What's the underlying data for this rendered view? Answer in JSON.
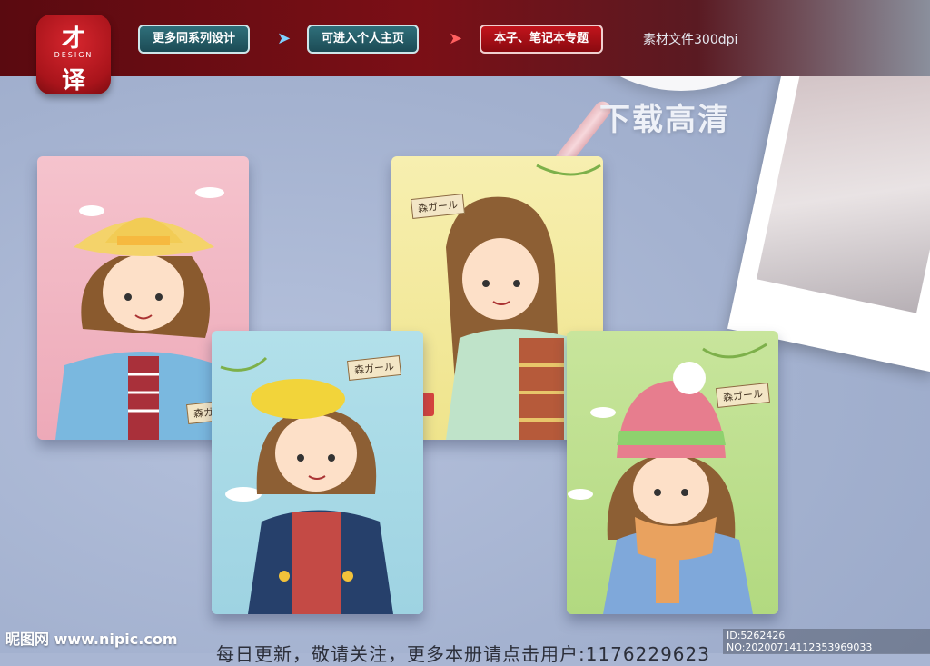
{
  "header": {
    "logo": {
      "line1": "才",
      "line2": "DESIGN",
      "line3": "译"
    },
    "nav": [
      {
        "label": "更多同系列设计"
      },
      {
        "label": "可进入个人主页"
      },
      {
        "label": "本子、笔记本专题"
      }
    ],
    "dpi_text": "素材文件300dpi"
  },
  "download_text": "下载高清",
  "cards": [
    {
      "label": "森ガール",
      "color": "#f2b8c4"
    },
    {
      "label": "森ガール",
      "color": "#f6eda6"
    },
    {
      "label": "森ガール",
      "color": "#a7d9e6"
    },
    {
      "label": "森ガール",
      "color": "#bfe08f"
    }
  ],
  "footer": {
    "watermark": "昵图网 www.nipic.com",
    "notice": "每日更新，敬请关注，更多本册请点击用户:1176229623",
    "id_text": "ID:5262426 NO:20200714112353969033"
  },
  "colors": {
    "brand_red": "#b0141b",
    "nav_teal": "#2f6f7a"
  }
}
